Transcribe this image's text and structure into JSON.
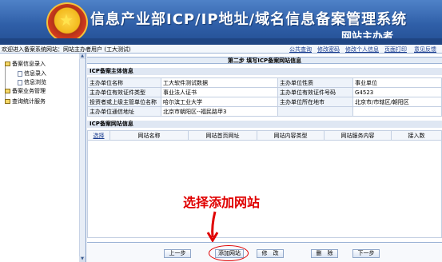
{
  "banner": {
    "title": "信息产业部ICP/IP地址/域名信息备案管理系统",
    "subtitle": "网站主办者"
  },
  "topbar": {
    "user": "欢迎进入备案系统网站：网站主办者用户 (工大测试)",
    "links": [
      "公共查询",
      "修改密码",
      "修改个人信息",
      "页面打印",
      "意见反馈"
    ]
  },
  "sidebar": {
    "items": [
      {
        "label": "备案信息录入"
      },
      {
        "label": "信息录入"
      },
      {
        "label": "信息浏览"
      },
      {
        "label": "备案业务管理"
      },
      {
        "label": "查询统计服务"
      }
    ]
  },
  "main": {
    "step_title": "第二步 填写ICP备案网站信息",
    "entity_section": "ICP备案主体信息",
    "entity_rows": [
      [
        "主办单位名称",
        "工大软件测试数据",
        "主办单位性质",
        "事业单位"
      ],
      [
        "主办单位有效证件类型",
        "事业法人证书",
        "主办单位有效证件号码",
        "G4523"
      ],
      [
        "投资者或上级主管单位名称",
        "哈尔滨工业大学",
        "主办单位所在地市",
        "北京市/市辖区/朝阳区"
      ],
      [
        "主办单位通信地址",
        "北京市朝阳区--福民路甲3",
        "",
        ""
      ]
    ],
    "site_section": "ICP备案网站信息",
    "site_headers": [
      "选择",
      "网站名称",
      "网站首页网址",
      "网站内容类型",
      "网站服务内容",
      "接入数"
    ],
    "annotation": "选择添加网站",
    "buttons": [
      "上一步",
      "添加网站",
      "修　改",
      "删　除",
      "下一步"
    ]
  },
  "colors": {
    "banner": "#2f5fa8",
    "annotation": "#e00000"
  }
}
